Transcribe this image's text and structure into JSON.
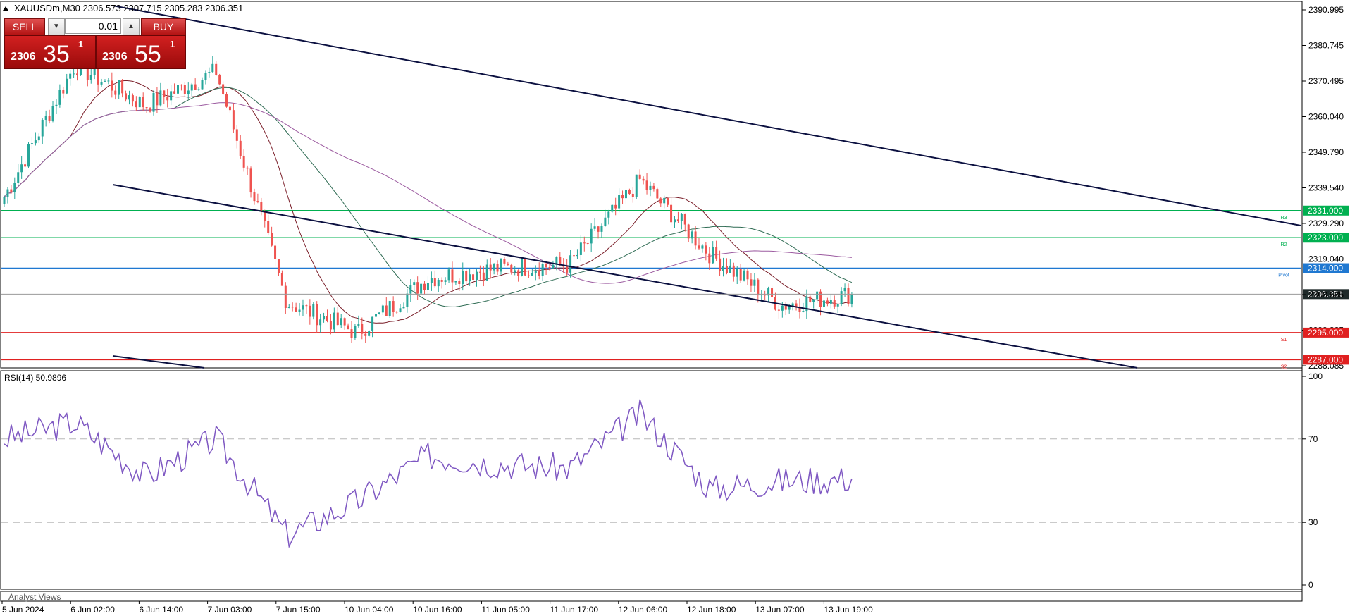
{
  "symbol_header": {
    "text": "XAUUSDm,M30  2306.573 2307.715 2305.283 2306.351",
    "arrow_icon": "triangle-up-icon"
  },
  "trade_panel": {
    "sell_label": "SELL",
    "buy_label": "BUY",
    "lot_value": "0.01",
    "lot_down_icon": "triangle-down-icon",
    "lot_up_icon": "triangle-up-icon",
    "sell_price": {
      "main": "2306",
      "big": "35",
      "small": "1"
    },
    "buy_price": {
      "main": "2306",
      "big": "55",
      "small": "1"
    }
  },
  "price_axis": {
    "labels": [
      "2390.995",
      "2380.745",
      "2370.495",
      "2360.040",
      "2349.790",
      "2339.540",
      "2329.290",
      "2319.040",
      "2308.585",
      "2298.335",
      "2288.085"
    ],
    "current_price": "2306.351"
  },
  "levels": [
    {
      "value": 2331.0,
      "label": "2331.000",
      "tag": "R3",
      "color": "#00b050",
      "box_text_color": "#ffffff"
    },
    {
      "value": 2323.0,
      "label": "2323.000",
      "tag": "R2",
      "color": "#00b050",
      "box_text_color": "#ffffff"
    },
    {
      "value": 2314.0,
      "label": "2314.000",
      "tag": "Pivot",
      "color": "#1f78d1",
      "box_text_color": "#ffffff"
    },
    {
      "value": 2295.0,
      "label": "2295.000",
      "tag": "S1",
      "color": "#e02020",
      "box_text_color": "#ffffff"
    },
    {
      "value": 2287.0,
      "label": "2287.000",
      "tag": "S2",
      "color": "#e02020",
      "box_text_color": "#ffffff"
    }
  ],
  "rsi_panel": {
    "label": "RSI(14) 50.9896",
    "levels": [
      "100",
      "70",
      "30",
      "0"
    ]
  },
  "analyst_bar": {
    "label": "Analyst Views"
  },
  "time_axis": {
    "labels": [
      "5 Jun 2024",
      "6 Jun 02:00",
      "6 Jun 14:00",
      "7 Jun 03:00",
      "7 Jun 15:00",
      "10 Jun 04:00",
      "10 Jun 16:00",
      "11 Jun 05:00",
      "11 Jun 17:00",
      "12 Jun 06:00",
      "12 Jun 18:00",
      "13 Jun 07:00",
      "13 Jun 19:00"
    ]
  },
  "colors": {
    "bull": "#26a69a",
    "bear": "#ef5350",
    "trendline": "#0b1040",
    "rsi": "#7e57c2",
    "ma_fast": "#7b1f2a",
    "ma_mid": "#2e6b53",
    "ma_slow": "#9c5ba0"
  },
  "chart_data": [
    {
      "type": "candlestick",
      "title": "XAUUSDm,M30",
      "ylim": [
        2285.0,
        2392.5
      ],
      "x": [
        "5 Jun 2024",
        "6 Jun 02:00",
        "6 Jun 14:00",
        "7 Jun 03:00",
        "7 Jun 15:00",
        "10 Jun 04:00",
        "10 Jun 16:00",
        "11 Jun 05:00",
        "11 Jun 17:00",
        "12 Jun 06:00",
        "12 Jun 18:00",
        "13 Jun 07:00",
        "13 Jun 19:00"
      ],
      "close": [
        2335,
        2374,
        2362,
        2372,
        2304,
        2295,
        2311,
        2314,
        2315,
        2340,
        2318,
        2303,
        2306.351
      ],
      "series": [
        {
          "name": "candles",
          "values": [
            2335,
            2374,
            2362,
            2372,
            2304,
            2295,
            2311,
            2314,
            2315,
            2340,
            2318,
            2303,
            2306.351
          ]
        }
      ]
    },
    {
      "type": "line",
      "title": "RSI(14) 50.9896",
      "ylim": [
        0,
        100
      ],
      "x": [
        "5 Jun 2024",
        "6 Jun 02:00",
        "6 Jun 14:00",
        "7 Jun 03:00",
        "7 Jun 15:00",
        "10 Jun 04:00",
        "10 Jun 16:00",
        "11 Jun 05:00",
        "11 Jun 17:00",
        "12 Jun 06:00",
        "12 Jun 18:00",
        "13 Jun 07:00",
        "13 Jun 19:00"
      ],
      "series": [
        {
          "name": "RSI(14)",
          "values": [
            70,
            78,
            52,
            70,
            24,
            40,
            62,
            58,
            56,
            82,
            46,
            50,
            50.99
          ]
        }
      ]
    }
  ]
}
